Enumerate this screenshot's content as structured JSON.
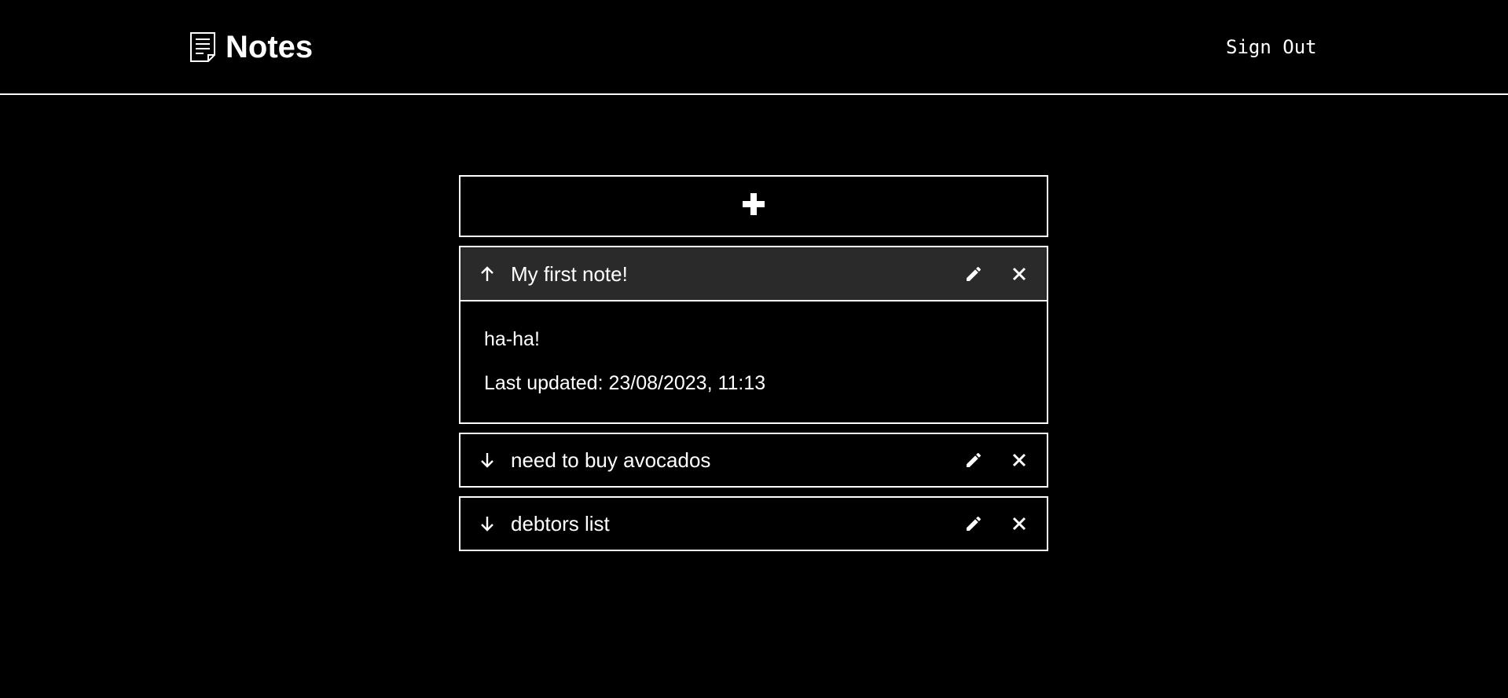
{
  "app": {
    "title": "Notes",
    "signout_label": "Sign Out"
  },
  "add_button": {
    "icon": "plus-icon"
  },
  "notes": [
    {
      "title": "My first note!",
      "expanded": true,
      "toggle_icon": "arrow-up-icon",
      "content": "ha-ha!",
      "updated_text": "Last updated: 23/08/2023, 11:13"
    },
    {
      "title": "need to buy avocados",
      "expanded": false,
      "toggle_icon": "arrow-down-icon"
    },
    {
      "title": "debtors list",
      "expanded": false,
      "toggle_icon": "arrow-down-icon"
    }
  ],
  "colors": {
    "background": "#000000",
    "foreground": "#ffffff",
    "expanded_header": "#2a2a2a"
  }
}
